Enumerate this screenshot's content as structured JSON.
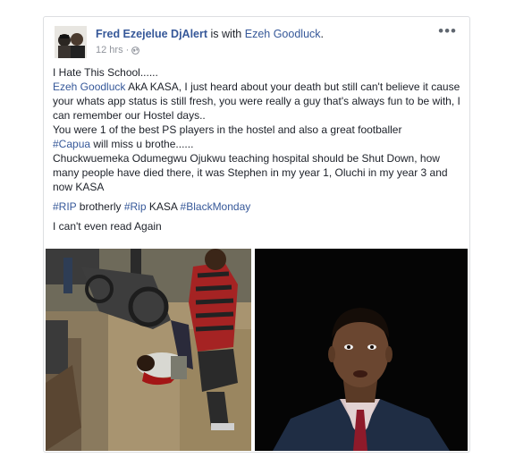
{
  "post": {
    "author": "Fred Ezejelue DjAlert",
    "with_text": "is with",
    "tagged": "Ezeh Goodluck",
    "tagged_suffix": ".",
    "time": "12 hrs",
    "meta_sep": "·",
    "more": "•••",
    "lines": {
      "l1": "I Hate This School......",
      "l2_link": "Ezeh Goodluck",
      "l2_rest": " AkA KASA, I just heard about your death but still can't believe it cause your whats app status is still fresh, you were really a guy that's always fun to be with, I can remember our Hostel days..",
      "l3": "You were 1 of the best PS players in the hostel and also a great footballer",
      "l4_tag": "#Capua",
      "l4_rest": " will miss u brothe......",
      "l5": "Chuckwuemeka Odumegwu Ojukwu teaching hospital should be Shut Down, how many people have died there, it was Stephen in my year 1, Oluchi in my year 3 and now KASA"
    },
    "hashtags": {
      "rip": "#RIP",
      "brotherly": " brotherly ",
      "riptag": "#Rip",
      "kasa": " KASA ",
      "blackmonday": "#BlackMonday"
    },
    "closing": "I can't even read Again"
  },
  "colors": {
    "link": "#365899",
    "text": "#1d2129",
    "meta": "#90949c"
  },
  "icons": {
    "globe": "globe-icon",
    "more": "more-options-icon"
  }
}
